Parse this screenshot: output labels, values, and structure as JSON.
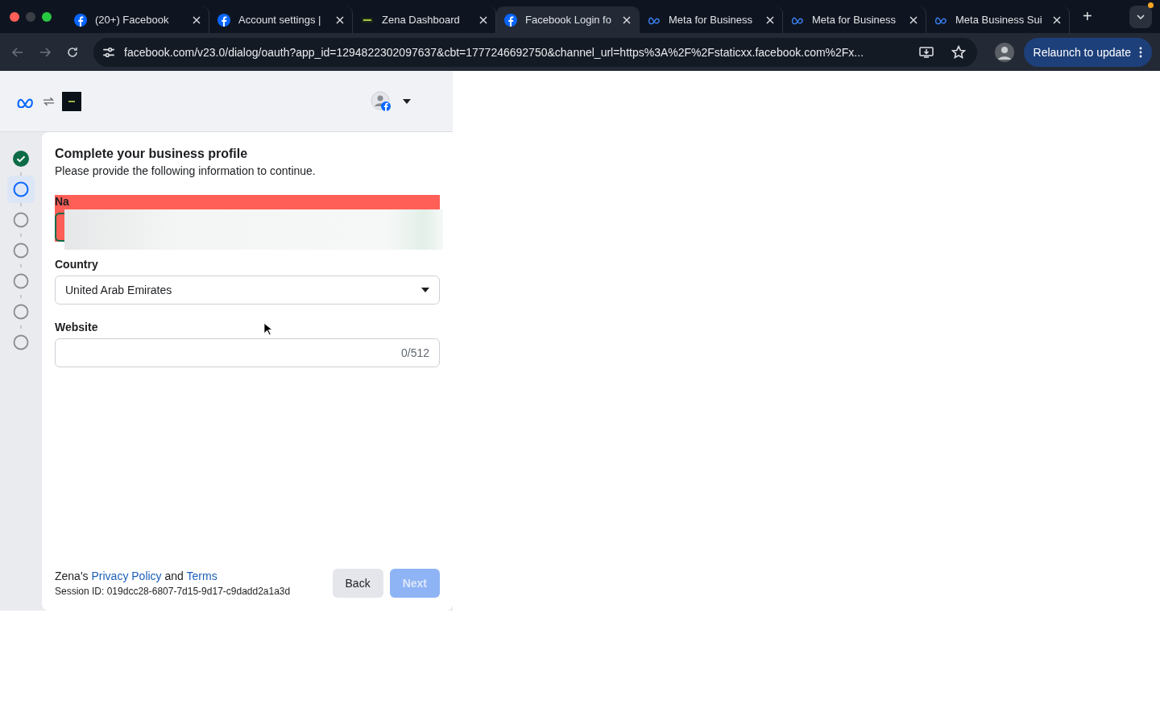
{
  "browser": {
    "tabs": [
      {
        "title": "(20+) Facebook",
        "kind": "facebook",
        "selected": false
      },
      {
        "title": "Account settings |",
        "kind": "facebook",
        "selected": false
      },
      {
        "title": "Zena Dashboard",
        "kind": "app",
        "selected": false
      },
      {
        "title": "Facebook Login fo",
        "kind": "facebook",
        "selected": true
      },
      {
        "title": "Meta for Business",
        "kind": "meta",
        "selected": false
      },
      {
        "title": "Meta for Business",
        "kind": "meta",
        "selected": false
      },
      {
        "title": "Meta Business Sui",
        "kind": "meta",
        "selected": false
      }
    ],
    "new_tab": "+",
    "url": "facebook.com/v23.0/dialog/oauth?app_id=1294822302097637&cbt=1777246692750&channel_url=https%3A%2F%2Fstaticxx.facebook.com%2Fx...",
    "relaunch_button": "Relaunch to update"
  },
  "steps": [
    {
      "checked": true,
      "selected": false
    },
    {
      "checked": false,
      "selected": true
    },
    {
      "checked": false,
      "selected": false
    },
    {
      "checked": false,
      "selected": false
    },
    {
      "checked": false,
      "selected": false
    },
    {
      "checked": false,
      "selected": false
    },
    {
      "checked": false,
      "selected": false
    }
  ],
  "form": {
    "title": "Complete your business profile",
    "subtitle": "Please provide the following information to continue.",
    "fields": [
      {
        "kind": "redacted",
        "label": "Na"
      },
      {
        "kind": "select",
        "label": "Country",
        "value": "United Arab Emirates"
      },
      {
        "kind": "text",
        "label": "Website",
        "counter": "0/512"
      }
    ]
  },
  "footer": {
    "legal": [
      {
        "kind": "text",
        "text": "Zena's"
      },
      {
        "kind": "link",
        "text": "Privacy Policy"
      },
      {
        "kind": "text",
        "text": "and"
      },
      {
        "kind": "link",
        "text": "Terms"
      }
    ],
    "session": "Session ID: 019dcc28-6807-7d15-9d17-c9dadd2a1a3d",
    "buttons": [
      {
        "label": "Back",
        "disabled": false
      },
      {
        "label": "Next",
        "disabled": true
      }
    ]
  }
}
